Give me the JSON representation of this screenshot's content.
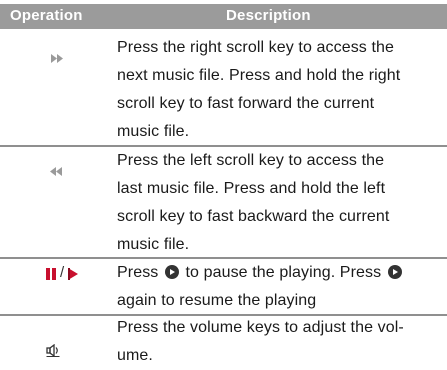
{
  "header": {
    "operation": "Operation",
    "description": "Description"
  },
  "rows": [
    {
      "icon": "fast-forward-icon",
      "lines": [
        "Press the right scroll key to access the",
        "next music file. Press and hold the right",
        "scroll key to fast forward the current",
        "music file."
      ]
    },
    {
      "icon": "rewind-icon",
      "lines": [
        "Press the left scroll key to access the",
        "last music file. Press and hold the left",
        "scroll key to fast backward the current",
        "music file."
      ]
    },
    {
      "icon": "pause-play-icon",
      "separator": "/",
      "line1_before": "Press",
      "line1_after": "to pause the playing. Press",
      "line2_before": "again to resume the playing",
      "inline_icon": "ok-key-icon"
    },
    {
      "icon": "volume-icon",
      "lines": [
        "Press the volume keys to adjust the vol-",
        "ume."
      ]
    }
  ],
  "colors": {
    "header_bg": "#9b9b9b",
    "icon_red": "#c8102e",
    "icon_gray": "#9a9a9a"
  }
}
